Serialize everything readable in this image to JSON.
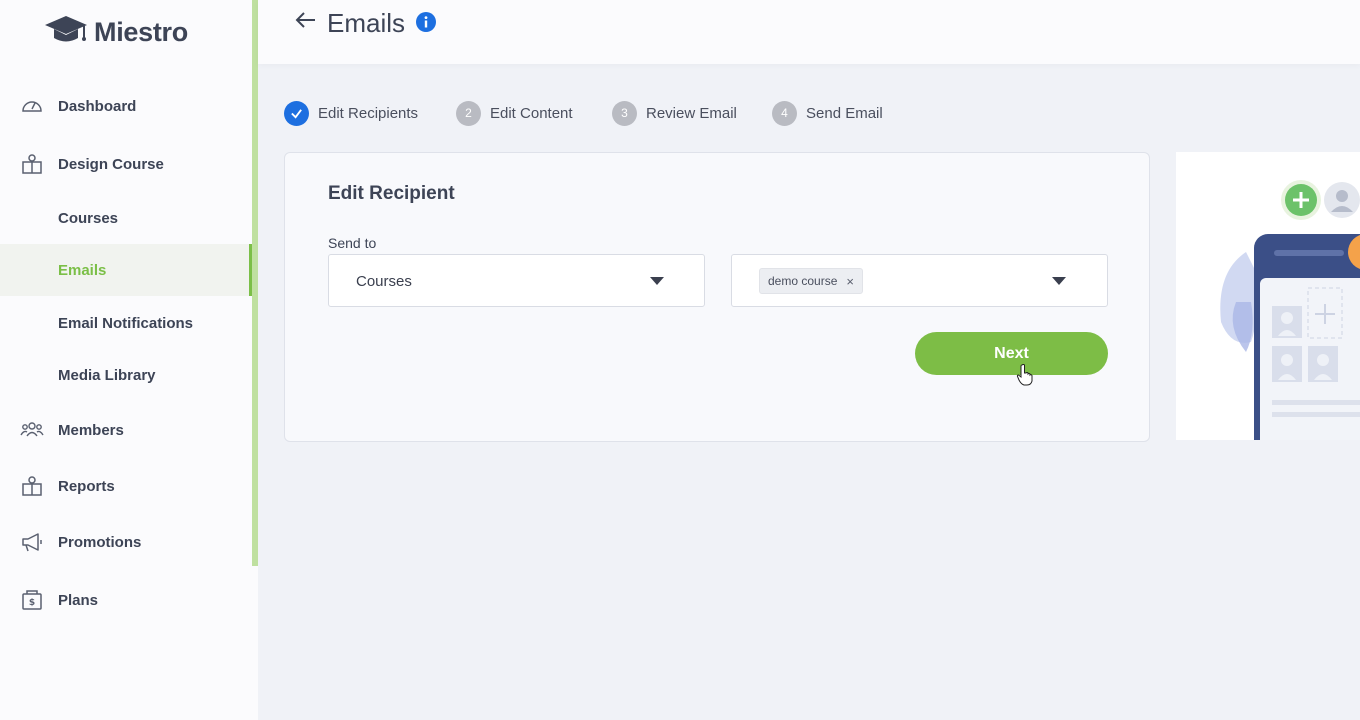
{
  "app": {
    "name": "Miestro"
  },
  "sidebar": {
    "items": [
      {
        "label": "Dashboard",
        "icon": "dashboard-gauge-icon"
      },
      {
        "label": "Design Course",
        "icon": "design-course-icon"
      },
      {
        "label": "Courses"
      },
      {
        "label": "Emails",
        "active": true
      },
      {
        "label": "Email Notifications"
      },
      {
        "label": "Media Library"
      },
      {
        "label": "Members",
        "icon": "members-icon"
      },
      {
        "label": "Reports",
        "icon": "reports-icon"
      },
      {
        "label": "Promotions",
        "icon": "megaphone-icon"
      },
      {
        "label": "Plans",
        "icon": "plans-icon"
      }
    ]
  },
  "header": {
    "title": "Emails",
    "back_icon": "back-arrow-icon",
    "info_icon": "info-icon"
  },
  "steps": [
    {
      "number": "",
      "label": "Edit Recipients",
      "status": "done"
    },
    {
      "number": "2",
      "label": "Edit Content",
      "status": "pending"
    },
    {
      "number": "3",
      "label": "Review Email",
      "status": "pending"
    },
    {
      "number": "4",
      "label": "Send Email",
      "status": "pending"
    }
  ],
  "card": {
    "title": "Edit Recipient",
    "send_to_label": "Send to",
    "send_to_value": "Courses",
    "selected_tags": [
      {
        "label": "demo course",
        "remove": "×"
      }
    ],
    "next_label": "Next"
  },
  "colors": {
    "accent_green": "#7dbd46",
    "step_done_blue": "#1d6fe0",
    "step_pending_gray": "#b9bbc2",
    "text_dark": "#3d4456"
  }
}
